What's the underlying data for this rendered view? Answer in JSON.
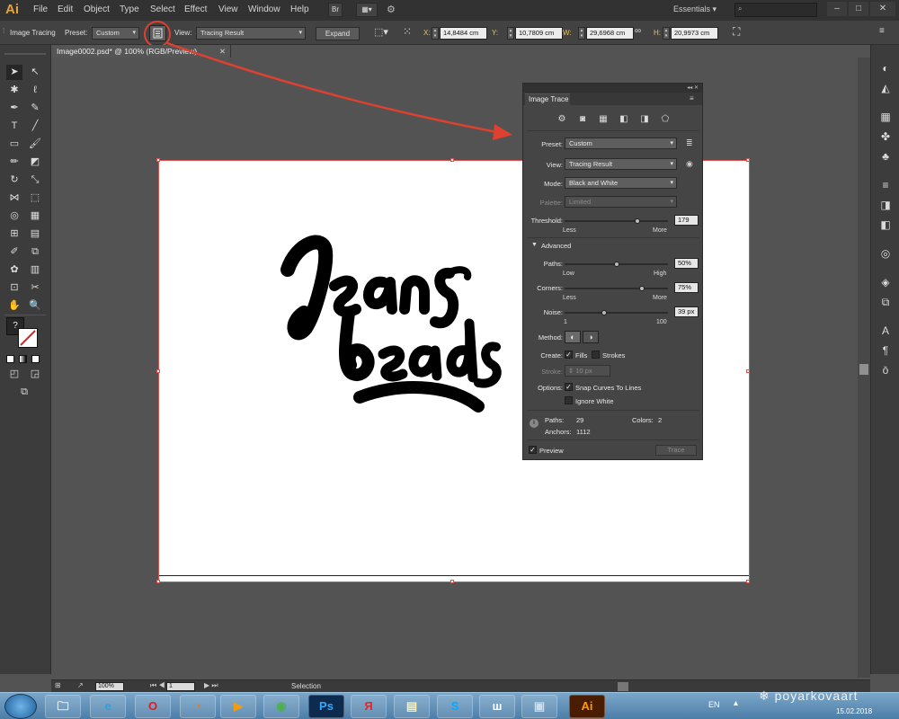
{
  "app": {
    "logo": "Ai"
  },
  "menu": [
    "File",
    "Edit",
    "Object",
    "Type",
    "Select",
    "Effect",
    "View",
    "Window",
    "Help"
  ],
  "menubar": {
    "bridge_label": "Br",
    "workspace": "Essentials"
  },
  "control_bar": {
    "image_tracing_label": "Image Tracing",
    "preset_label": "Preset:",
    "preset_value": "Custom",
    "view_label": "View:",
    "view_value": "Tracing Result",
    "expand_label": "Expand",
    "x_label": "X:",
    "x_value": "14,8484 cm",
    "y_label": "Y:",
    "y_value": "10,7809 cm",
    "w_label": "W:",
    "w_value": "29,6968 cm",
    "h_label": "H:",
    "h_value": "20,9973 cm"
  },
  "document": {
    "tab_title": "Image0002.psd* @ 100% (RGB/Preview)"
  },
  "image_trace": {
    "title": "Image Trace",
    "preset_label": "Preset:",
    "preset_value": "Custom",
    "view_label": "View:",
    "view_value": "Tracing Result",
    "mode_label": "Mode:",
    "mode_value": "Black and White",
    "palette_label": "Palette:",
    "palette_value": "Limited",
    "threshold_label": "Threshold:",
    "threshold_value": "179",
    "threshold_fraction": 0.7,
    "threshold_less": "Less",
    "threshold_more": "More",
    "advanced_label": "Advanced",
    "paths_label": "Paths:",
    "paths_value": "50%",
    "paths_fraction": 0.5,
    "paths_low": "Low",
    "paths_high": "High",
    "corners_label": "Corners:",
    "corners_value": "75%",
    "corners_fraction": 0.75,
    "corners_less": "Less",
    "corners_more": "More",
    "noise_label": "Noise:",
    "noise_value": "39 px",
    "noise_fraction": 0.38,
    "noise_min": "1",
    "noise_max": "100",
    "method_label": "Method:",
    "create_label": "Create:",
    "fills_label": "Fills",
    "strokes_label": "Strokes",
    "stroke_label": "Stroke:",
    "stroke_value": "10 px",
    "options_label": "Options:",
    "snap_label": "Snap Curves To Lines",
    "ignore_white_label": "Ignore White",
    "paths_count_label": "Paths:",
    "paths_count": "29",
    "colors_label": "Colors:",
    "colors_count": "2",
    "anchors_label": "Anchors:",
    "anchors_count": "1112",
    "preview_label": "Preview",
    "trace_label": "Trace"
  },
  "status_bar": {
    "zoom": "100%",
    "artboard": "1",
    "tool": "Selection"
  },
  "taskbar": {
    "apps": [
      "folder-icon",
      "ie-icon",
      "opera-icon",
      "firefox-icon",
      "media-player-icon",
      "chrome-icon",
      "ps-label",
      "yandex-icon",
      "notes-icon",
      "skype-icon",
      "w-icon",
      "photos-icon",
      "ai-label"
    ],
    "ps_label": "Ps",
    "ai_label": "Ai",
    "yandex_label": "Я",
    "w_label": "ш",
    "language": "EN",
    "date": "15.02.2018"
  },
  "watermark": "poyarkovaart",
  "colors": {
    "accent_red": "#e04030",
    "ai_orange": "#e8a33c",
    "panel_bg": "#454545"
  }
}
